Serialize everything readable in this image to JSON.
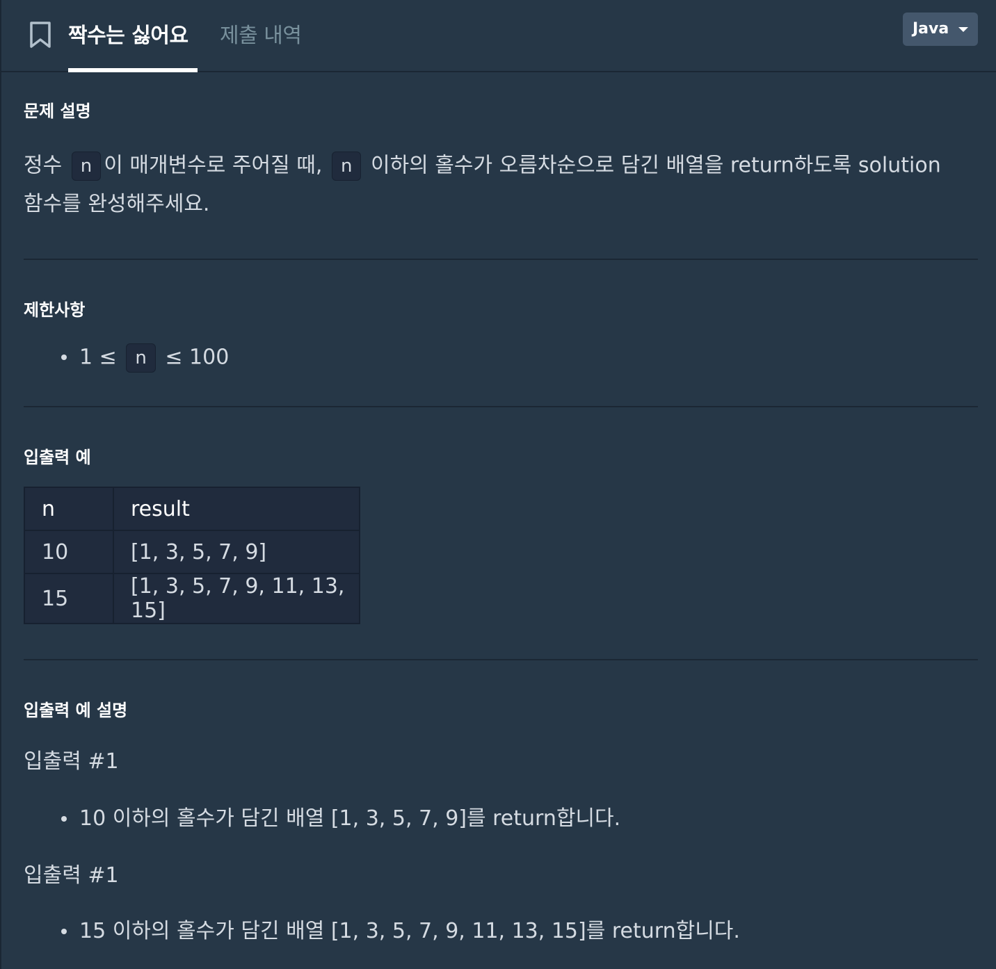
{
  "header": {
    "tabs": [
      {
        "label": "짝수는 싫어요",
        "active": true
      },
      {
        "label": "제출 내역",
        "active": false
      }
    ],
    "language": "Java",
    "bookmark_icon": "bookmark-icon"
  },
  "description": {
    "title": "문제 설명",
    "parts": [
      "정수",
      "n",
      "이 매개변수로 주어질 때,",
      "n",
      "이하의 홀수가 오름차순으로 담긴 배열을 return하도록 solution"
    ],
    "line2": "함수를 완성해주세요."
  },
  "constraints": {
    "title": "제한사항",
    "item_prefix": "1 ≤",
    "item_code": "n",
    "item_suffix": "≤ 100"
  },
  "examples": {
    "title": "입출력 예",
    "columns": [
      "n",
      "result"
    ],
    "rows": [
      [
        "10",
        "[1, 3, 5, 7, 9]"
      ],
      [
        "15",
        "[1, 3, 5, 7, 9, 11, 13, 15]"
      ]
    ]
  },
  "explanation": {
    "title": "입출력 예 설명",
    "cases": [
      {
        "heading": "입출력 #1",
        "text": "10 이하의 홀수가 담긴 배열 [1, 3, 5, 7, 9]를 return합니다."
      },
      {
        "heading": "입출력 #1",
        "text": "15 이하의 홀수가 담긴 배열 [1, 3, 5, 7, 9, 11, 13, 15]를 return합니다."
      }
    ]
  },
  "colors": {
    "background": "#263747",
    "text": "#d5dbe2",
    "heading": "#ffffff",
    "code_bg": "#202b3d",
    "select_bg": "#44576c"
  }
}
